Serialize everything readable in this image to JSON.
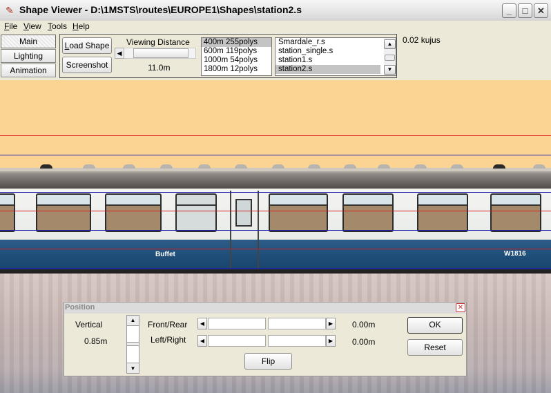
{
  "window": {
    "title": "Shape Viewer - D:\\1MSTS\\routes\\EUROPE1\\Shapes\\station2.s",
    "icon": "app-icon",
    "controls": {
      "minimize": "_",
      "maximize": "□",
      "close": "✕"
    }
  },
  "menu": {
    "items": [
      {
        "label": "File",
        "mnemonic": "F",
        "rest": "ile"
      },
      {
        "label": "View",
        "mnemonic": "V",
        "rest": "iew"
      },
      {
        "label": "Tools",
        "mnemonic": "T",
        "rest": "ools"
      },
      {
        "label": "Help",
        "mnemonic": "H",
        "rest": "elp"
      }
    ]
  },
  "tabs": {
    "main": "Main",
    "lighting": "Lighting",
    "animation": "Animation",
    "selected": "Main"
  },
  "toolbar": {
    "load_shape_prefix": "L",
    "load_shape_rest": "oad Shape",
    "screenshot": "Screenshot",
    "viewing_distance_label": "Viewing Distance",
    "viewing_distance_value": "11.0m",
    "lod_levels": [
      {
        "text": "400m 255polys",
        "selected": true
      },
      {
        "text": "600m 119polys",
        "selected": false
      },
      {
        "text": "1000m 54polys",
        "selected": false
      },
      {
        "text": "1800m 12polys",
        "selected": false
      }
    ],
    "shape_files": [
      {
        "text": "Smardale_r.s",
        "selected": false
      },
      {
        "text": "station_single.s",
        "selected": false
      },
      {
        "text": "station1.s",
        "selected": false
      },
      {
        "text": "station2.s",
        "selected": true
      }
    ],
    "timing": "0.02 kujus"
  },
  "viewport": {
    "car_labels": {
      "buffet": "Buffet",
      "number": "W1816"
    },
    "colors": {
      "sky": "#fbd494",
      "livery_blue": "#1f4e7a",
      "livery_white": "#eceeeb",
      "guide_red": "#d81c1c",
      "guide_blue": "#2020b0"
    }
  },
  "position_dialog": {
    "title": "Position",
    "close": "✕",
    "vertical_label": "Vertical",
    "vertical_value": "0.85m",
    "front_rear_label": "Front/Rear",
    "front_rear_value": "0.00m",
    "left_right_label": "Left/Right",
    "left_right_value": "0.00m",
    "flip": "Flip",
    "ok": "OK",
    "reset": "Reset"
  }
}
